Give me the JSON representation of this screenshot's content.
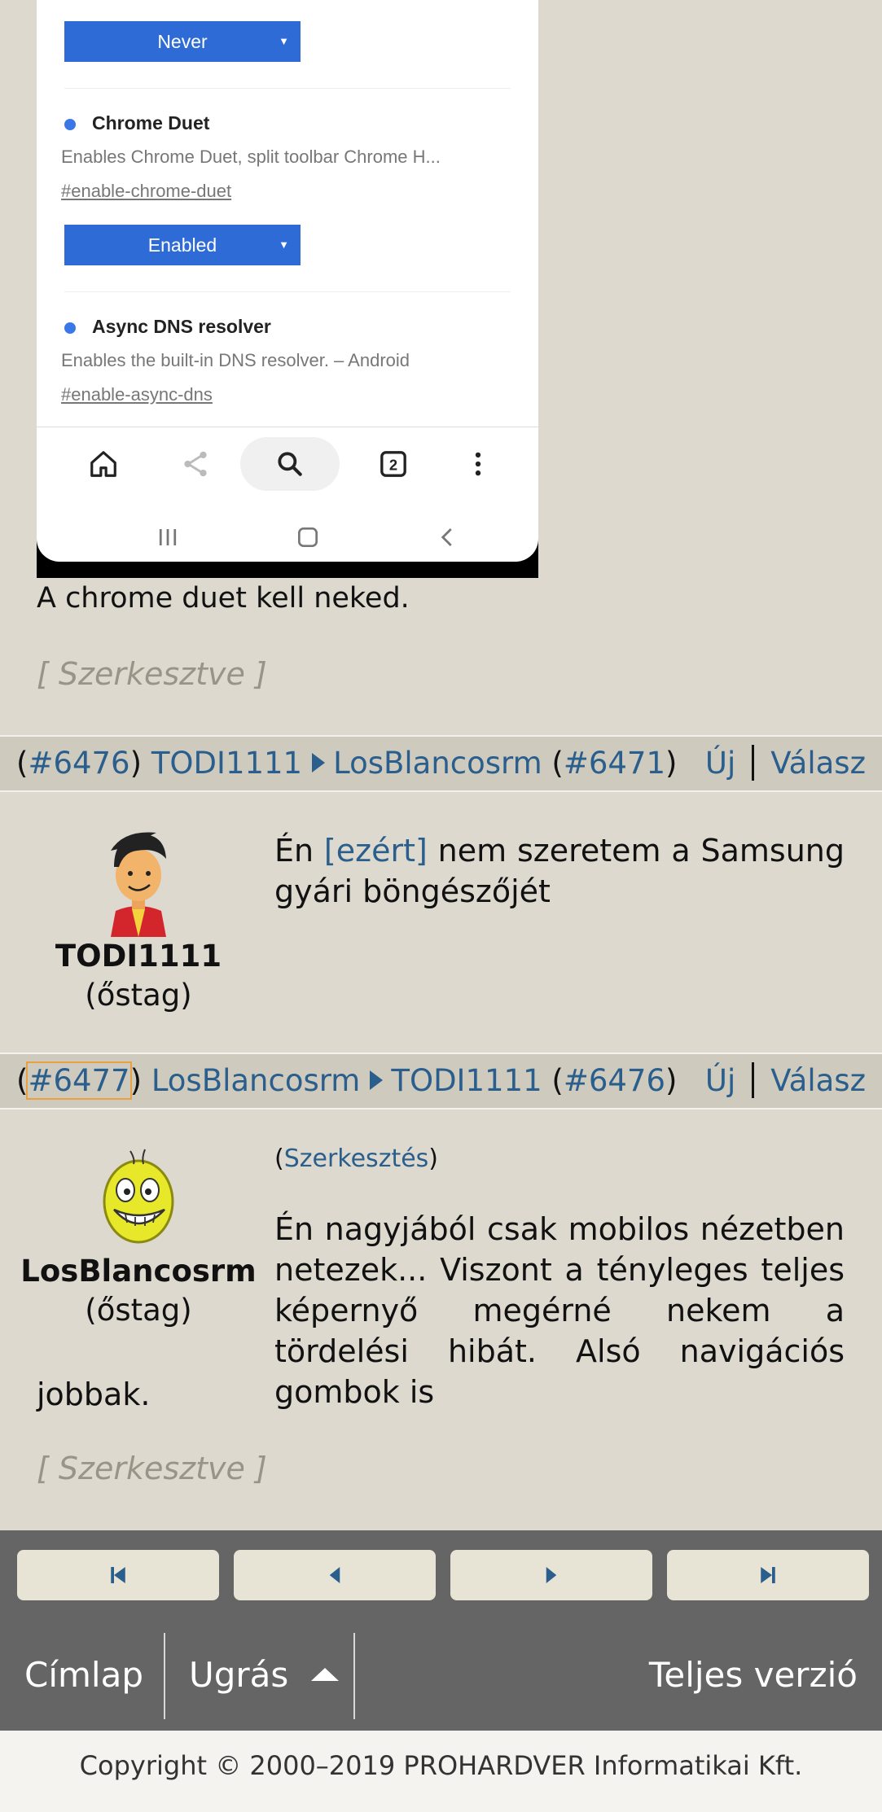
{
  "screenshot": {
    "flags": [
      {
        "select_value": "Never"
      },
      {
        "name": "Chrome Duet",
        "description": "Enables Chrome Duet, split toolbar Chrome H...",
        "link": "#enable-chrome-duet",
        "select_value": "Enabled"
      },
      {
        "name": "Async DNS resolver",
        "description": "Enables the built-in DNS resolver. – Android",
        "link": "#enable-async-dns"
      }
    ],
    "tab_count": "2",
    "icons": [
      "home-icon",
      "share-icon",
      "search-icon",
      "tabs-icon",
      "more-vert-icon",
      "recents-icon",
      "home-square-icon",
      "back-icon"
    ]
  },
  "post_prev": {
    "text": "A chrome duet kell neked.",
    "edited_label": "[ Szerkesztve ]"
  },
  "post1": {
    "id_link": "#6476",
    "author": "TODI1111",
    "reply_to": "LosBlancosrm",
    "reply_id": "#6471",
    "new_label": "Új",
    "reply_label": "Válasz",
    "user_name": "TODI1111",
    "user_rank": "(őstag)",
    "text_before": "Én ",
    "text_link": "[ezért]",
    "text_after": " nem szeretem a Samsung gyári böngészőjét"
  },
  "post2": {
    "id_link": "#6477",
    "author": "LosBlancosrm",
    "reply_to": "TODI1111",
    "reply_id": "#6476",
    "new_label": "Új",
    "reply_label": "Válasz",
    "user_name": "LosBlancosrm",
    "user_rank": "(őstag)",
    "edit_link": "Szerkesztés",
    "text": "Én nagyjából csak mobilos nézetben netezek... Viszont a tényleges teljes képernyő megérné nekem a tördelési hibát. Alsó navigációs gombok is",
    "text_tail": "jobbak.",
    "edited_label": "[ Szerkesztve ]"
  },
  "pager": {
    "icons": [
      "first-page-icon",
      "prev-page-icon",
      "next-page-icon",
      "last-page-icon"
    ]
  },
  "nav": {
    "home": "Címlap",
    "jump": "Ugrás",
    "full": "Teljes verzió"
  },
  "footer": {
    "copyright": "Copyright © 2000–2019 PROHARDVER Informatikai Kft."
  },
  "colors": {
    "background": "#ddd9cf",
    "header_bar": "#cfcabe",
    "link": "#2a5e8c",
    "dark_bar": "#666565",
    "chrome_blue": "#2f6bd6"
  }
}
